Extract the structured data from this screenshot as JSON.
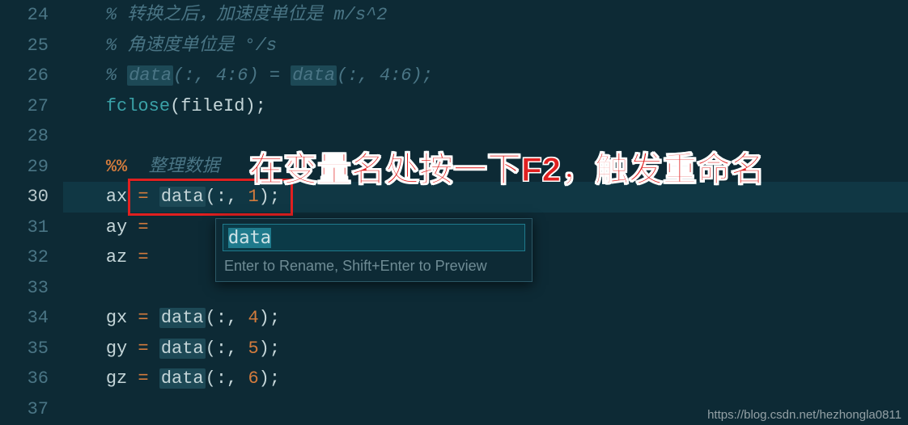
{
  "annotation_text": "在变量名处按一下F2，触发重命名",
  "watermark": "https://blog.csdn.net/hezhongla0811",
  "rename": {
    "value": "data",
    "hint": "Enter to Rename, Shift+Enter to Preview"
  },
  "gutter": {
    "24": "24",
    "25": "25",
    "26": "26",
    "27": "27",
    "28": "28",
    "29": "29",
    "30": "30",
    "31": "31",
    "32": "32",
    "33": "33",
    "34": "34",
    "35": "35",
    "36": "36",
    "37": "37"
  },
  "code": {
    "l24_comment": "% 转换之后，加速度单位是 m/s^2",
    "l25_comment": "% 角速度单位是 °/s",
    "l26_c_pre": "% ",
    "l26_c_data1": "data",
    "l26_c_mid": "(:, 4:6) = ",
    "l26_c_data2": "data",
    "l26_c_post": "(:, 4:6);",
    "l27_call": "fclose",
    "l27_open": "(",
    "l27_arg": "fileId",
    "l27_close": ");",
    "l29_sec": "%%",
    "l29_text": "  整理数据",
    "l30_ax": "ax",
    "l30_eq": " = ",
    "l30_data": "data",
    "l30_open": "(:, ",
    "l30_n": "1",
    "l30_close": ");",
    "l31_ay": "ay",
    "l31_eq": " = ",
    "l32_az": "az",
    "l32_eq": " = ",
    "l34_gx": "gx",
    "l34_eq": " = ",
    "l34_data": "data",
    "l34_open": "(:, ",
    "l34_n": "4",
    "l34_close": ");",
    "l35_gy": "gy",
    "l35_eq": " = ",
    "l35_data": "data",
    "l35_open": "(:, ",
    "l35_n": "5",
    "l35_close": ");",
    "l36_gz": "gz",
    "l36_eq": " = ",
    "l36_data": "data",
    "l36_open": "(:, ",
    "l36_n": "6",
    "l36_close": ");"
  }
}
